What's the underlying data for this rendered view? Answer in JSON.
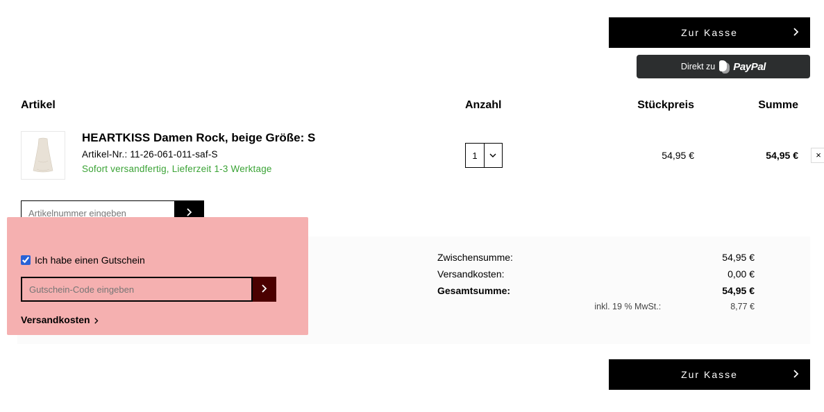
{
  "buttons": {
    "checkout": "Zur Kasse",
    "paypal_prefix": "Direkt zu",
    "paypal_brand": "PayPal"
  },
  "headers": {
    "item": "Artikel",
    "qty": "Anzahl",
    "unit": "Stückpreis",
    "sum": "Summe"
  },
  "item": {
    "title": "HEARTKISS Damen Rock, beige Größe: S",
    "sku_label": "Artikel-Nr.:  11-26-061-011-saf-S",
    "availability": "Sofort versandfertig, Lieferzeit 1-3 Werktage",
    "qty": "1",
    "unit_price": "54,95 €",
    "sum": "54,95 €",
    "remove": "×"
  },
  "sku_add": {
    "placeholder": "Artikelnummer eingeben"
  },
  "coupon": {
    "label": "Ich habe einen Gutschein",
    "placeholder": "Gutschein-Code eingeben",
    "shipping_link": "Versandkosten"
  },
  "totals": {
    "subtotal_label": "Zwischensumme:",
    "subtotal_value": "54,95 €",
    "shipping_label": "Versandkosten:",
    "shipping_value": "0,00 €",
    "total_label": "Gesamtsumme:",
    "total_value": "54,95 €",
    "tax_label": "inkl. 19 % MwSt.:",
    "tax_value": "8,77 €"
  }
}
